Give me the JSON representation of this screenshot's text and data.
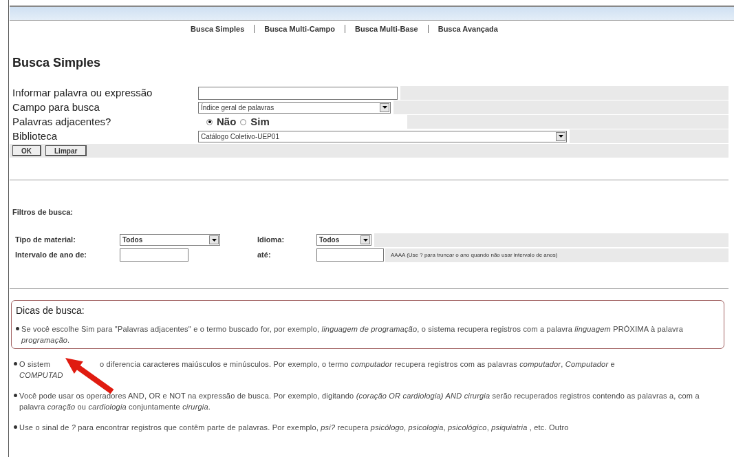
{
  "nav": [
    {
      "label": "Busca Simples"
    },
    {
      "label": "Busca Multi-Campo"
    },
    {
      "label": "Busca Multi-Base"
    },
    {
      "label": "Busca Avançada"
    }
  ],
  "title": "Busca Simples",
  "form": {
    "query_label": "Informar palavra ou expressão",
    "field_label": "Campo para busca",
    "field_value": "Índice geral de palavras",
    "adjacent_label": "Palavras adjacentes?",
    "adjacent_options": [
      {
        "label": "Não",
        "selected": true
      },
      {
        "label": "Sim",
        "selected": false
      }
    ],
    "library_label": "Biblioteca",
    "library_value": "Catálogo Coletivo-UEP01",
    "buttons": [
      "OK",
      "Limpar"
    ]
  },
  "filters": {
    "heading": "Filtros de busca:",
    "material_label": "Tipo de material:",
    "material_value": "Todos",
    "language_label": "Idioma:",
    "language_value": "Todos",
    "year_from_label": "Intervalo de ano de:",
    "year_to_label": "até:",
    "year_hint": "AAAA (Use ? para truncar o ano quando não usar intervalo de anos)"
  },
  "tips": {
    "heading": "Dicas de busca:",
    "items": [
      {
        "text": "Se você escolhe Sim para \"Palavras adjacentes\" e o termo buscado for, por exemplo, *linguagem de programação*, o sistema recupera registros com a palavra *linguagem* PRÓXIMA à palavra *programação*.",
        "boxed": true
      },
      {
        "parts": [
          "O sistem",
          "o diferencia caracteres maiúsculos e minúsculos. Por exemplo, o termo *computador* recupera registros com as palavras *computador*, *Computador* e",
          "*COMPUTAD*"
        ],
        "boxed": false
      },
      {
        "text": "Você pode usar os operadores AND, OR e NOT na expressão de busca. Por exemplo, digitando *(coração OR cardiologia) AND cirurgia* serão recuperados registros contendo as palavras a, com a palavra *coração* ou *cardiologia* conjuntamente *cirurgia*.",
        "boxed": false
      },
      {
        "text": "Use o sinal de *?* para encontrar registros que contêm parte de palavras. Por exemplo, *psi?* recupera *psicólogo*, *psicologia*, *psicológico*, *psiquiatria* , etc. Outro",
        "boxed": false
      }
    ]
  }
}
